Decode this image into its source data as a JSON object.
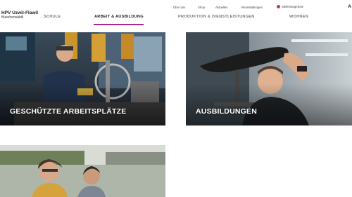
{
  "brand": {
    "name_line1": "HPV Uzwil-Flawil",
    "name_line2": "Buecherwäldli"
  },
  "topnav": {
    "items": [
      "Über uns",
      "Shop",
      "Aktuelles",
      "Veranstaltungen"
    ],
    "jobs_label": "Stellenangebote",
    "lang": "A"
  },
  "mainnav": {
    "items": [
      "SCHULE",
      "ARBEIT & AUSBILDUNG",
      "PRODUKTION & DIENSTLEISTUNGEN",
      "WOHNEN"
    ],
    "active": "ARBEIT & AUSBILDUNG"
  },
  "tiles": [
    {
      "caption": "GESCHÜTZTE ARBEITSPLÄTZE"
    },
    {
      "caption": "AUSBILDUNGEN"
    },
    {
      "caption": ""
    }
  ],
  "colors": {
    "accent": "#a7298a",
    "jobs_dot": "#c0326e"
  }
}
